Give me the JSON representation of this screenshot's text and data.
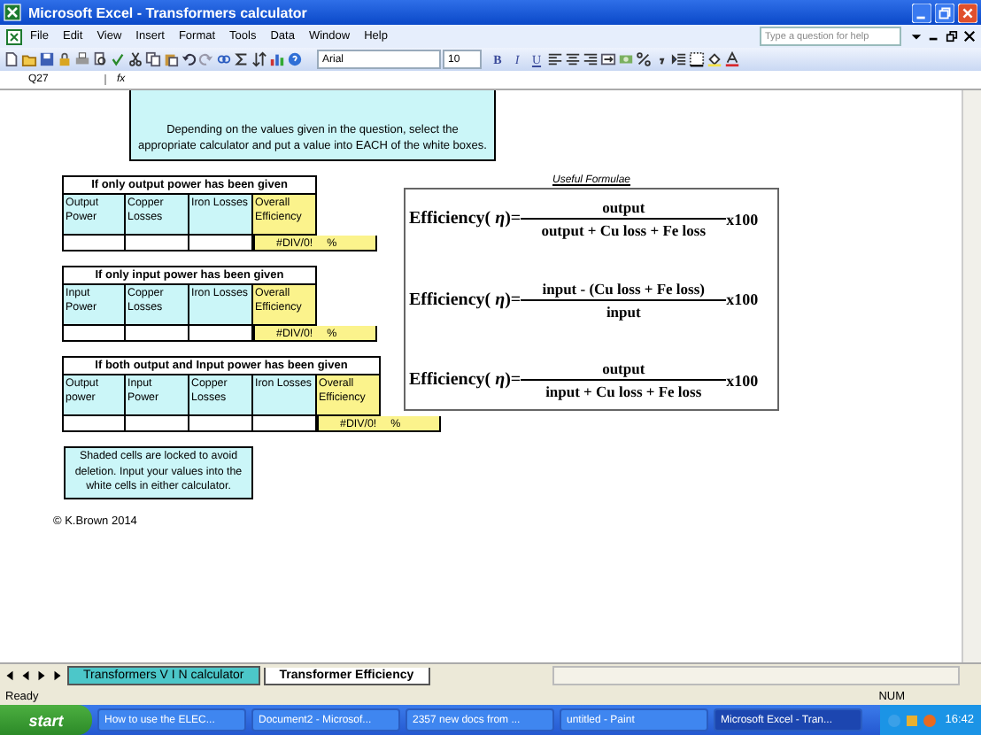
{
  "window": {
    "title": "Microsoft Excel - Transformers calculator"
  },
  "menu": [
    "File",
    "Edit",
    "View",
    "Insert",
    "Format",
    "Tools",
    "Data",
    "Window",
    "Help"
  ],
  "help_search": {
    "placeholder": "Type a question for help"
  },
  "formatting": {
    "font": "Arial",
    "size": "10",
    "bold": "B",
    "italic": "I",
    "underline": "U"
  },
  "formula_bar": {
    "name_box": "Q27",
    "fx": "fx"
  },
  "instruction": "Depending on the values given in the question, select the appropriate calculator and put a value into EACH of the white boxes.",
  "calculators": [
    {
      "title": "If only output power has been given",
      "headers": [
        "Output Power",
        "Copper Losses",
        "Iron Losses"
      ],
      "result_header": "Overall Efficiency",
      "result": "#DIV/0!",
      "unit": "%"
    },
    {
      "title": "If only input power has been given",
      "headers": [
        "Input Power",
        "Copper Losses",
        "Iron Losses"
      ],
      "result_header": "Overall Efficiency",
      "result": "#DIV/0!",
      "unit": "%"
    },
    {
      "title": "If both output and Input power has been given",
      "headers": [
        "Output power",
        "Input Power",
        "Copper Losses",
        "Iron Losses"
      ],
      "result_header": "Overall Efficiency",
      "result": "#DIV/0!",
      "unit": "%"
    }
  ],
  "formulae": {
    "title": "Useful Formulae",
    "items": [
      {
        "label": "Efficiency( *η*)=",
        "numerator": "output",
        "denominator": "output + Cu loss + Fe loss",
        "factor": "x100"
      },
      {
        "label": "Efficiency( *η*)=",
        "numerator": "input - (Cu loss + Fe loss)",
        "denominator": "input",
        "factor": "x100"
      },
      {
        "label": "Efficiency( *η*)=",
        "numerator": "output",
        "denominator": "input + Cu loss + Fe loss",
        "factor": "x100"
      }
    ]
  },
  "note": "Shaded cells are locked to avoid deletion. Input your values into the white cells in either calculator.",
  "copyright": "© K.Brown 2014",
  "sheet_tabs": [
    {
      "label": "Transformers V I N calculator",
      "selected": false
    },
    {
      "label": "Transformer Efficiency",
      "selected": true
    }
  ],
  "status_bar": {
    "mode": "Ready",
    "num": "NUM"
  },
  "taskbar": {
    "start": "start",
    "tasks": [
      {
        "label": "How to use the ELEC...",
        "selected": false
      },
      {
        "label": "Document2 - Microsof...",
        "selected": false
      },
      {
        "label": "2357 new docs from ...",
        "selected": false
      },
      {
        "label": "untitled - Paint",
        "selected": false
      },
      {
        "label": "Microsoft Excel - Tran...",
        "selected": true
      }
    ],
    "clock": "16:42"
  }
}
